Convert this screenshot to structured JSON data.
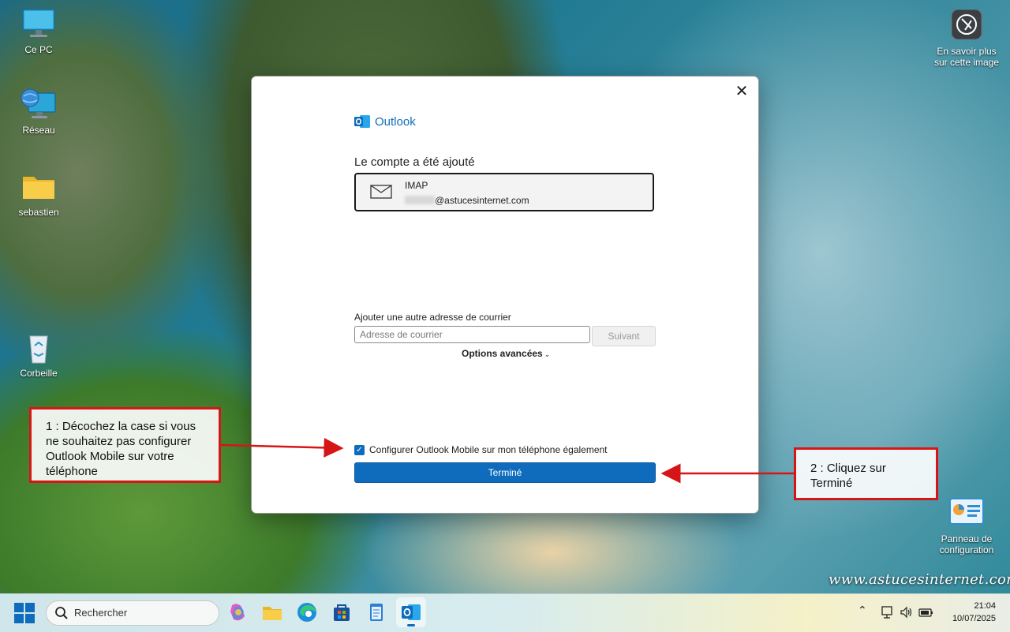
{
  "desktop": {
    "icons": [
      {
        "label": "Ce PC"
      },
      {
        "label": "Réseau"
      },
      {
        "label": "sebastien"
      },
      {
        "label": "Corbeille"
      }
    ],
    "right_icons": {
      "learn_more": "En savoir plus sur cette image",
      "control_panel": "Panneau de configuration"
    }
  },
  "dialog": {
    "brand": "Outlook",
    "heading": "Le compte a été ajouté",
    "account": {
      "type": "IMAP",
      "email_domain": "@astucesinternet.com"
    },
    "add_label": "Ajouter une autre adresse de courrier",
    "email_placeholder": "Adresse de courrier",
    "next_label": "Suivant",
    "advanced_label": "Options avancées",
    "checkbox_label": "Configurer Outlook Mobile sur mon téléphone également",
    "done_label": "Terminé"
  },
  "callouts": {
    "step1": "1 : Décochez la case si vous ne souhaitez pas configurer Outlook Mobile sur votre téléphone",
    "step2": "2 : Cliquez sur Terminé"
  },
  "watermark": "www.astucesinternet.com",
  "taskbar": {
    "search_text": "Rechercher",
    "time": "21:04",
    "date": "10/07/2025"
  },
  "colors": {
    "accent": "#0f6cbd",
    "callout_border": "#d61616"
  }
}
